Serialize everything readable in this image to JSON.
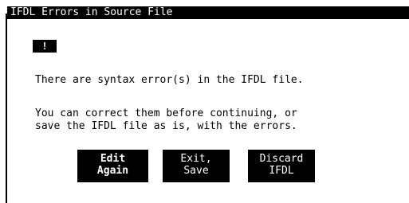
{
  "dialog": {
    "title": "IFDL Errors in Source File",
    "icon": "!",
    "message_line1": "There are syntax error(s) in the IFDL file.",
    "message_line2": "You can correct them before continuing, or",
    "message_line3": "save the IFDL file as is, with the errors."
  },
  "buttons": {
    "edit_again": {
      "line1": "Edit",
      "line2": "Again"
    },
    "exit_save": {
      "line1": "Exit,",
      "line2": "Save"
    },
    "discard_ifdl": {
      "line1": "Discard",
      "line2": "IFDL"
    }
  },
  "colors": {
    "foreground": "#000000",
    "background": "#ffffff"
  }
}
